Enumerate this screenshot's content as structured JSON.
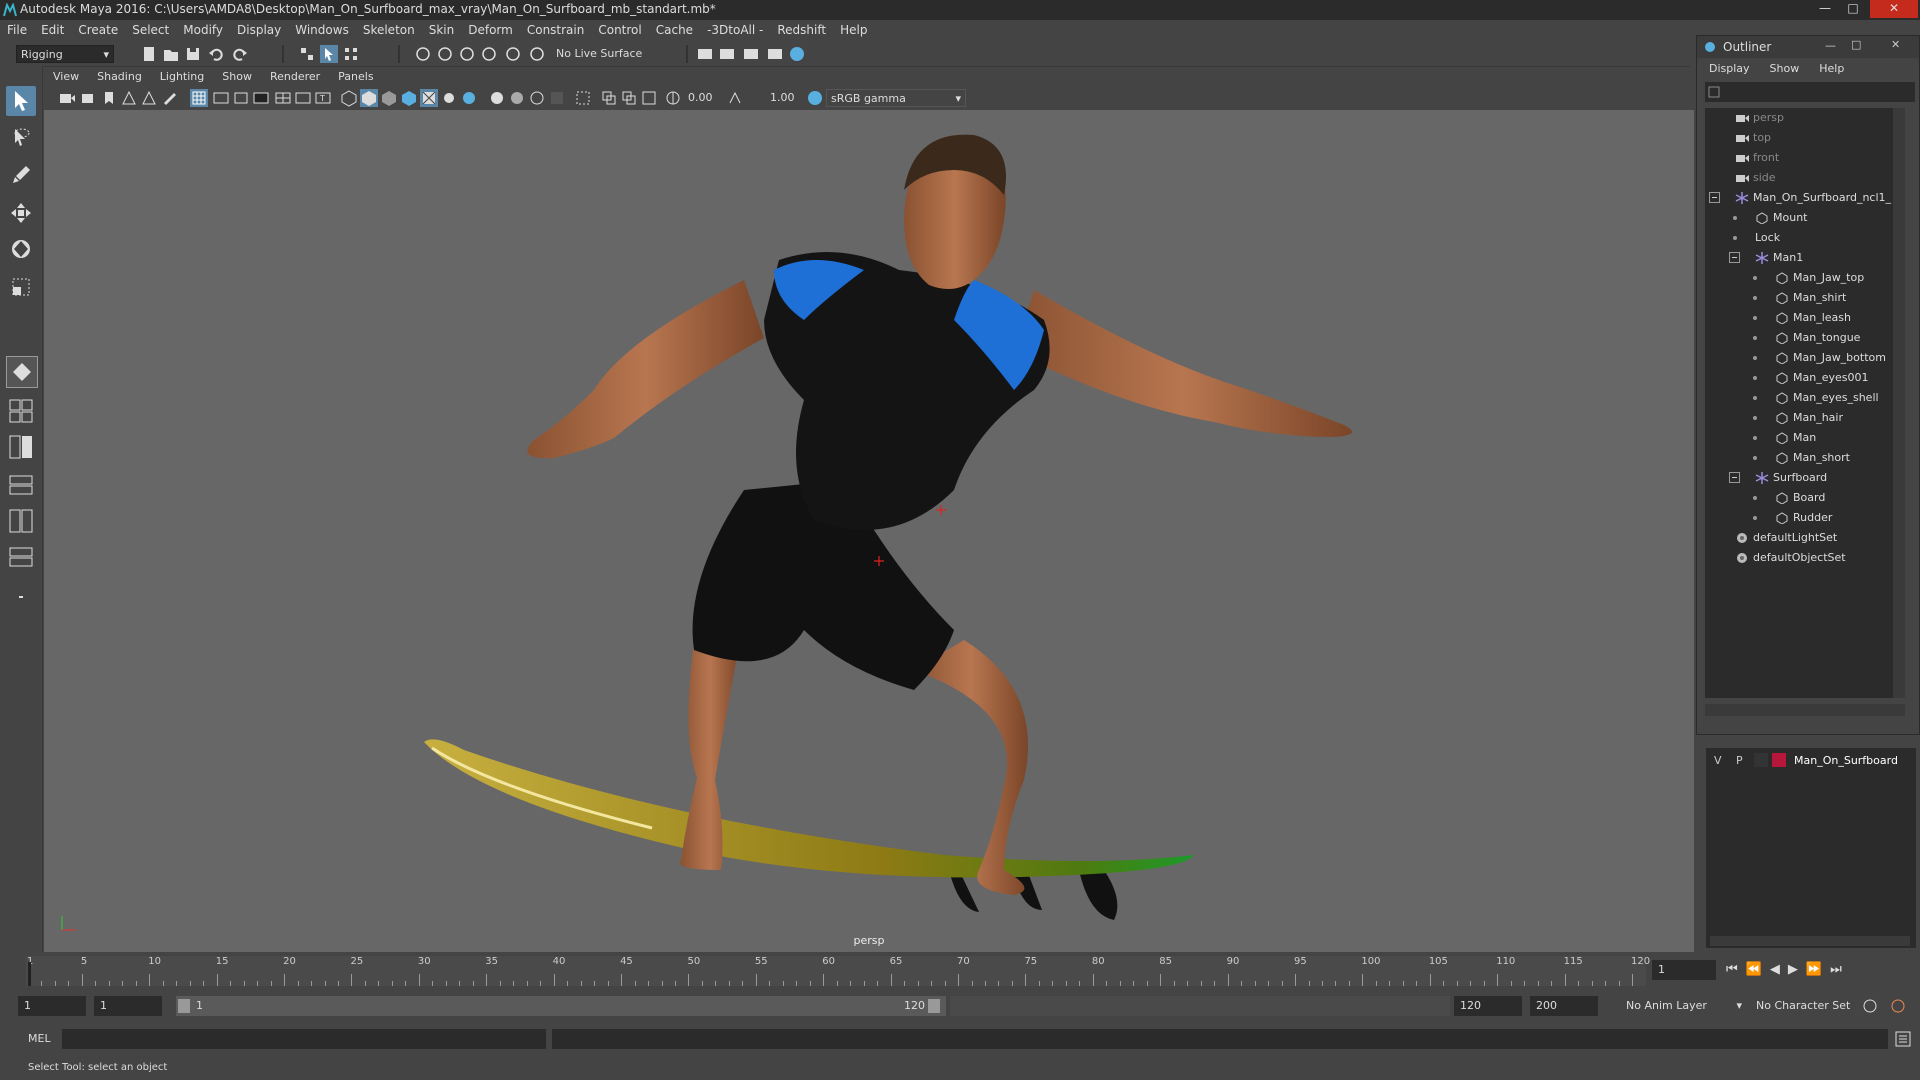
{
  "window": {
    "title": "Autodesk Maya 2016: C:\\Users\\AMDA8\\Desktop\\Man_On_Surfboard_max_vray\\Man_On_Surfboard_mb_standart.mb*"
  },
  "menubar": [
    "File",
    "Edit",
    "Create",
    "Select",
    "Modify",
    "Display",
    "Windows",
    "Skeleton",
    "Skin",
    "Deform",
    "Constrain",
    "Control",
    "Cache",
    "-3DtoAll -",
    "Redshift",
    "Help"
  ],
  "statusline": {
    "menuset": "Rigging",
    "live_surface": "No Live Surface"
  },
  "panel": {
    "menus": [
      "View",
      "Shading",
      "Lighting",
      "Show",
      "Renderer",
      "Panels"
    ],
    "exposure": "0.00",
    "gamma": "1.00",
    "colorspace": "sRGB gamma",
    "camera_label": "persp"
  },
  "outliner": {
    "title": "Outliner",
    "menus": [
      "Display",
      "Show",
      "Help"
    ],
    "items": [
      {
        "label": "persp",
        "kind": "camera",
        "depth": 0,
        "dim": true
      },
      {
        "label": "top",
        "kind": "camera",
        "depth": 0,
        "dim": true
      },
      {
        "label": "front",
        "kind": "camera",
        "depth": 0,
        "dim": true
      },
      {
        "label": "side",
        "kind": "camera",
        "depth": 0,
        "dim": true
      },
      {
        "label": "Man_On_Surfboard_ncl1_",
        "kind": "joint",
        "depth": 0,
        "expanded": true
      },
      {
        "label": "Mount",
        "kind": "mesh",
        "depth": 1
      },
      {
        "label": "Lock",
        "kind": "none",
        "depth": 1
      },
      {
        "label": "Man1",
        "kind": "joint",
        "depth": 1,
        "expanded": true
      },
      {
        "label": "Man_Jaw_top",
        "kind": "mesh",
        "depth": 2
      },
      {
        "label": "Man_shirt",
        "kind": "mesh",
        "depth": 2
      },
      {
        "label": "Man_leash",
        "kind": "mesh",
        "depth": 2
      },
      {
        "label": "Man_tongue",
        "kind": "mesh",
        "depth": 2
      },
      {
        "label": "Man_Jaw_bottom",
        "kind": "mesh",
        "depth": 2
      },
      {
        "label": "Man_eyes001",
        "kind": "mesh",
        "depth": 2
      },
      {
        "label": "Man_eyes_shell",
        "kind": "mesh",
        "depth": 2
      },
      {
        "label": "Man_hair",
        "kind": "mesh",
        "depth": 2
      },
      {
        "label": "Man",
        "kind": "mesh",
        "depth": 2
      },
      {
        "label": "Man_short",
        "kind": "mesh",
        "depth": 2
      },
      {
        "label": "Surfboard",
        "kind": "joint",
        "depth": 1,
        "expanded": true
      },
      {
        "label": "Board",
        "kind": "mesh",
        "depth": 2
      },
      {
        "label": "Rudder",
        "kind": "mesh",
        "depth": 2
      },
      {
        "label": "defaultLightSet",
        "kind": "set",
        "depth": 0
      },
      {
        "label": "defaultObjectSet",
        "kind": "set",
        "depth": 0
      }
    ]
  },
  "layers": {
    "v": "V",
    "p": "P",
    "name": "Man_On_Surfboard",
    "color": "#b5163a"
  },
  "timeline": {
    "ticks": [
      "1",
      "5",
      "10",
      "15",
      "20",
      "25",
      "30",
      "35",
      "40",
      "45",
      "50",
      "55",
      "60",
      "65",
      "70",
      "75",
      "80",
      "85",
      "90",
      "95",
      "100",
      "105",
      "110",
      "115",
      "120"
    ],
    "current_frame": "1"
  },
  "range": {
    "start": "1",
    "start_inner": "1",
    "slider_start": "1",
    "slider_end": "120",
    "end_inner": "120",
    "end": "200",
    "anim_layer": "No Anim Layer",
    "char_set": "No Character Set"
  },
  "cmdline": {
    "mode": "MEL"
  },
  "help": {
    "text": "Select Tool: select an object"
  },
  "colors": {
    "accent": "#5a87a8",
    "bg": "#444444",
    "viewport": "#676767"
  }
}
